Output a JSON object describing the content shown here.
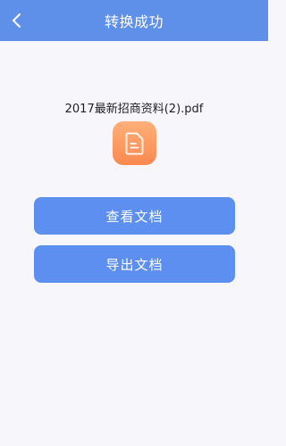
{
  "header": {
    "title": "转换成功",
    "back_icon": "chevron-left-icon",
    "background": "#5e90ea"
  },
  "file": {
    "name": "2017最新招商资料(2).pdf",
    "icon": "document-icon",
    "icon_color": "#f9894e"
  },
  "actions": {
    "view_label": "查看文档",
    "export_label": "导出文档",
    "button_color": "#5c8ff0"
  }
}
